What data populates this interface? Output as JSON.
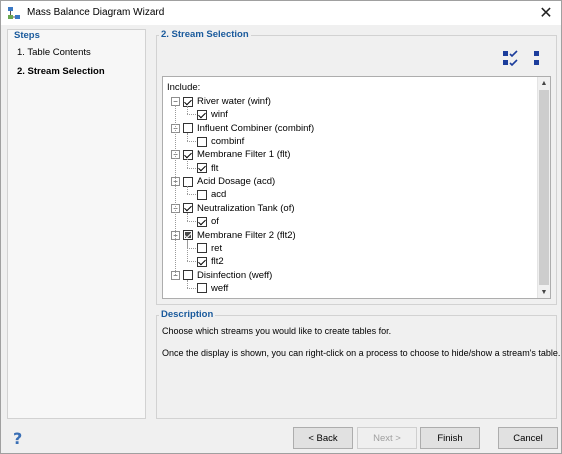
{
  "window": {
    "title": "Mass Balance Diagram Wizard",
    "close_symbol": "✕"
  },
  "steps": {
    "title": "Steps",
    "items": [
      {
        "label": "1. Table Contents",
        "active": false
      },
      {
        "label": "2. Stream Selection",
        "active": true
      }
    ]
  },
  "stream_selection": {
    "title": "2. Stream Selection",
    "toolbar": {
      "check_all_icon": "check-all-icon",
      "uncheck_all_icon": "uncheck-all-icon"
    },
    "include_label": "Include:",
    "tree": [
      {
        "label": "River water (winf)",
        "state": "checked",
        "children": [
          {
            "label": "winf",
            "state": "checked"
          }
        ]
      },
      {
        "label": "Influent Combiner  (combinf)",
        "state": "unchecked",
        "children": [
          {
            "label": "combinf",
            "state": "unchecked"
          }
        ]
      },
      {
        "label": "Membrane Filter 1 (flt)",
        "state": "checked",
        "children": [
          {
            "label": "flt",
            "state": "checked"
          }
        ]
      },
      {
        "label": "Acid Dosage (acd)",
        "state": "unchecked",
        "children": [
          {
            "label": "acd",
            "state": "unchecked"
          }
        ]
      },
      {
        "label": "Neutralization Tank  (of)",
        "state": "checked",
        "children": [
          {
            "label": "of",
            "state": "checked"
          }
        ]
      },
      {
        "label": "Membrane Filter 2 (flt2)",
        "state": "partial",
        "children": [
          {
            "label": "ret",
            "state": "unchecked"
          },
          {
            "label": "flt2",
            "state": "checked"
          }
        ]
      },
      {
        "label": "Disinfection (weff)",
        "state": "unchecked",
        "children": [
          {
            "label": "weff",
            "state": "unchecked"
          }
        ]
      }
    ],
    "expander_symbol": "−"
  },
  "description": {
    "title": "Description",
    "line1": "Choose which streams you would like to create tables for.",
    "line2": "Once the display is shown, you can right-click on a process to choose to hide/show a stream's table."
  },
  "buttons": {
    "back": "< Back",
    "next": "Next >",
    "finish": "Finish",
    "cancel": "Cancel",
    "next_enabled": false
  },
  "colors": {
    "accent": "#1a5a9c",
    "icon_blue": "#1c3d9c"
  }
}
